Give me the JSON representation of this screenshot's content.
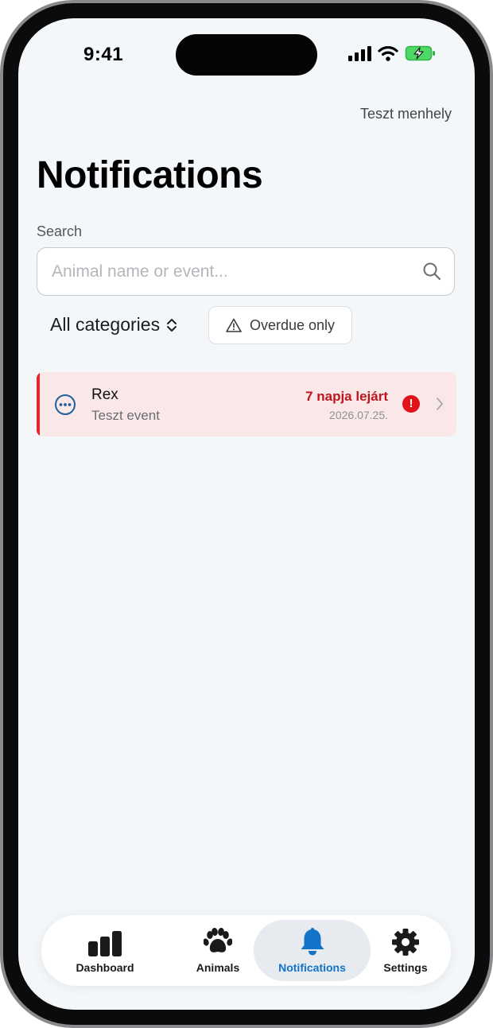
{
  "status_bar": {
    "time": "9:41"
  },
  "header": {
    "shelter_name": "Teszt menhely",
    "title": "Notifications"
  },
  "search": {
    "label": "Search",
    "placeholder": "Animal name or event...",
    "value": ""
  },
  "filters": {
    "category_selected": "All categories",
    "overdue_label": "Overdue only"
  },
  "notifications": [
    {
      "animal": "Rex",
      "event": "Teszt event",
      "overdue_text": "7 napja lejárt",
      "date": "2026.07.25.",
      "alert_symbol": "!",
      "icon": "more-circle-icon",
      "accent_color": "#e4262c"
    }
  ],
  "tabbar": {
    "active": "notifications",
    "accent_color": "#1273c8",
    "items": [
      {
        "key": "dashboard",
        "label": "Dashboard",
        "icon": "bar-chart-icon"
      },
      {
        "key": "animals",
        "label": "Animals",
        "icon": "paw-icon"
      },
      {
        "key": "notifications",
        "label": "Notifications",
        "icon": "bell-icon"
      },
      {
        "key": "settings",
        "label": "Settings",
        "icon": "gear-icon"
      }
    ]
  }
}
